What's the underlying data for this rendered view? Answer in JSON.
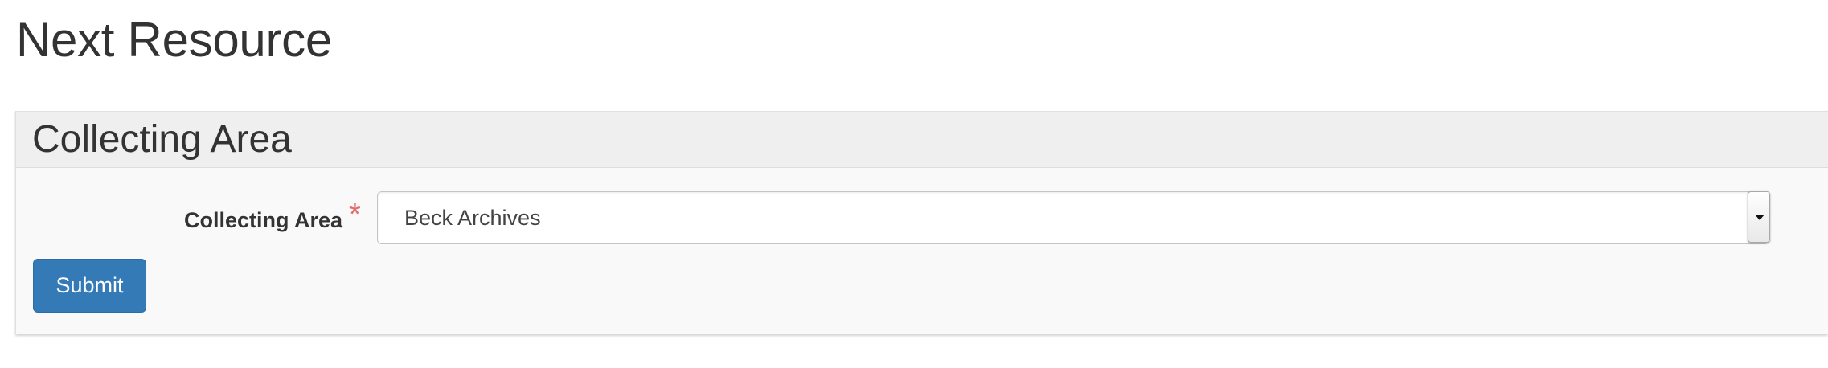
{
  "page": {
    "title": "Next Resource"
  },
  "panel": {
    "heading": "Collecting Area"
  },
  "form": {
    "collecting_area": {
      "label": "Collecting Area",
      "required_mark": "*",
      "selected_value": "Beck Archives"
    },
    "submit_label": "Submit"
  },
  "colors": {
    "primary_button": "#337ab7",
    "required_mark": "#e36d6d",
    "panel_heading_bg": "#efefef",
    "panel_body_bg": "#f9f9f9",
    "text": "#333333"
  },
  "icons": {
    "select_arrow": "chevron-down-icon"
  }
}
